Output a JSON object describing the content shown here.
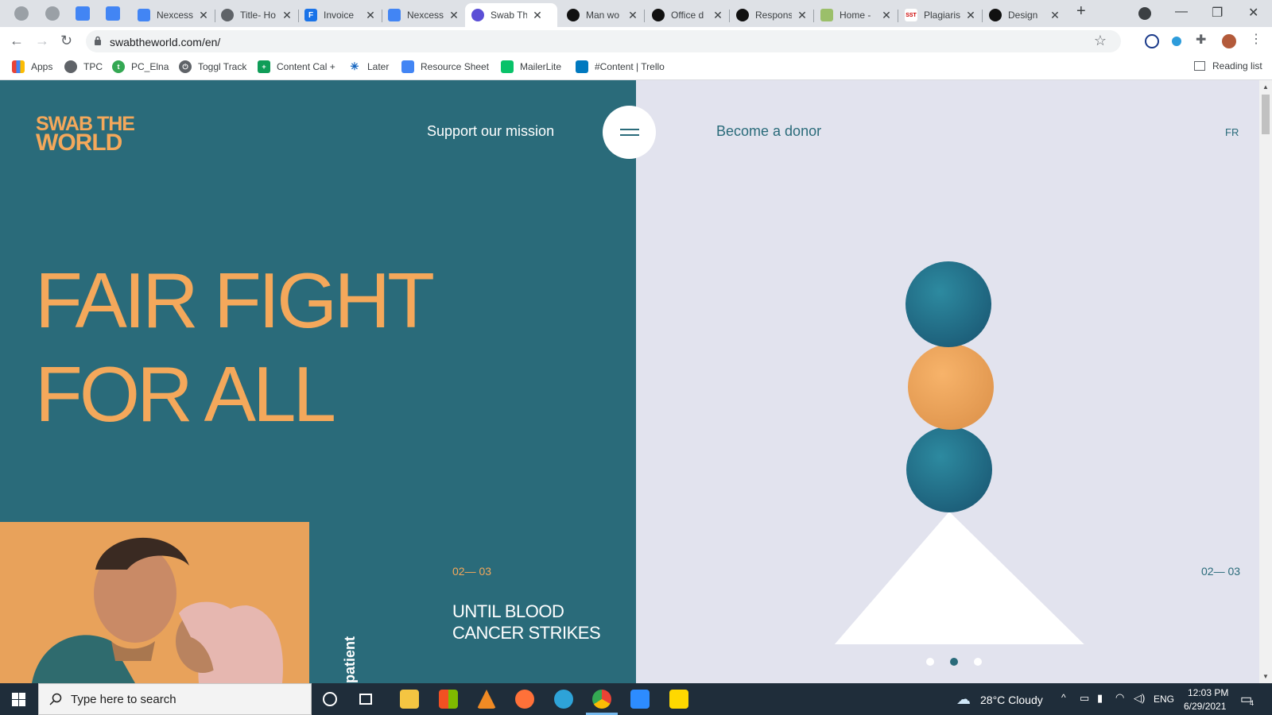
{
  "tabs": [
    {
      "title": "Nexcess"
    },
    {
      "title": "Title- Ho"
    },
    {
      "title": "Invoice"
    },
    {
      "title": "Nexcess"
    },
    {
      "title": "Swab Th"
    },
    {
      "title": "Man wo"
    },
    {
      "title": "Office d"
    },
    {
      "title": "Respons"
    },
    {
      "title": "Home -"
    },
    {
      "title": "Plagiaris"
    },
    {
      "title": "Design"
    }
  ],
  "address": {
    "url": "swabtheworld.com/en/"
  },
  "bookmarks": [
    {
      "label": "Apps"
    },
    {
      "label": "TPC"
    },
    {
      "label": "PC_Elna"
    },
    {
      "label": "Toggl Track"
    },
    {
      "label": "Content Cal +"
    },
    {
      "label": "Later"
    },
    {
      "label": "Resource Sheet"
    },
    {
      "label": "MailerLite"
    },
    {
      "label": "#Content | Trello"
    }
  ],
  "reading_list": "Reading list",
  "site": {
    "logo_line1": "SWAB THE",
    "logo_line2": "WORLD",
    "support": "Support our mission",
    "donor": "Become a donor",
    "lang": "FR",
    "headline_1": "FAIR FIGHT",
    "headline_2": "FOR ALL",
    "vertical_label": "patient",
    "counter_left": "02— 03",
    "counter_right": "02— 03",
    "slide_title": "UNTIL BLOOD CANCER STRIKES",
    "slider_dots": 3,
    "active_dot": 2
  },
  "colors": {
    "teal": "#2a6b7a",
    "orange": "#f4a85b",
    "lavender": "#e2e3ee"
  },
  "taskbar": {
    "search_placeholder": "Type here to search",
    "weather": "28°C  Cloudy",
    "language": "ENG",
    "time": "12:03 PM",
    "date": "6/29/2021",
    "notifications": "4"
  }
}
